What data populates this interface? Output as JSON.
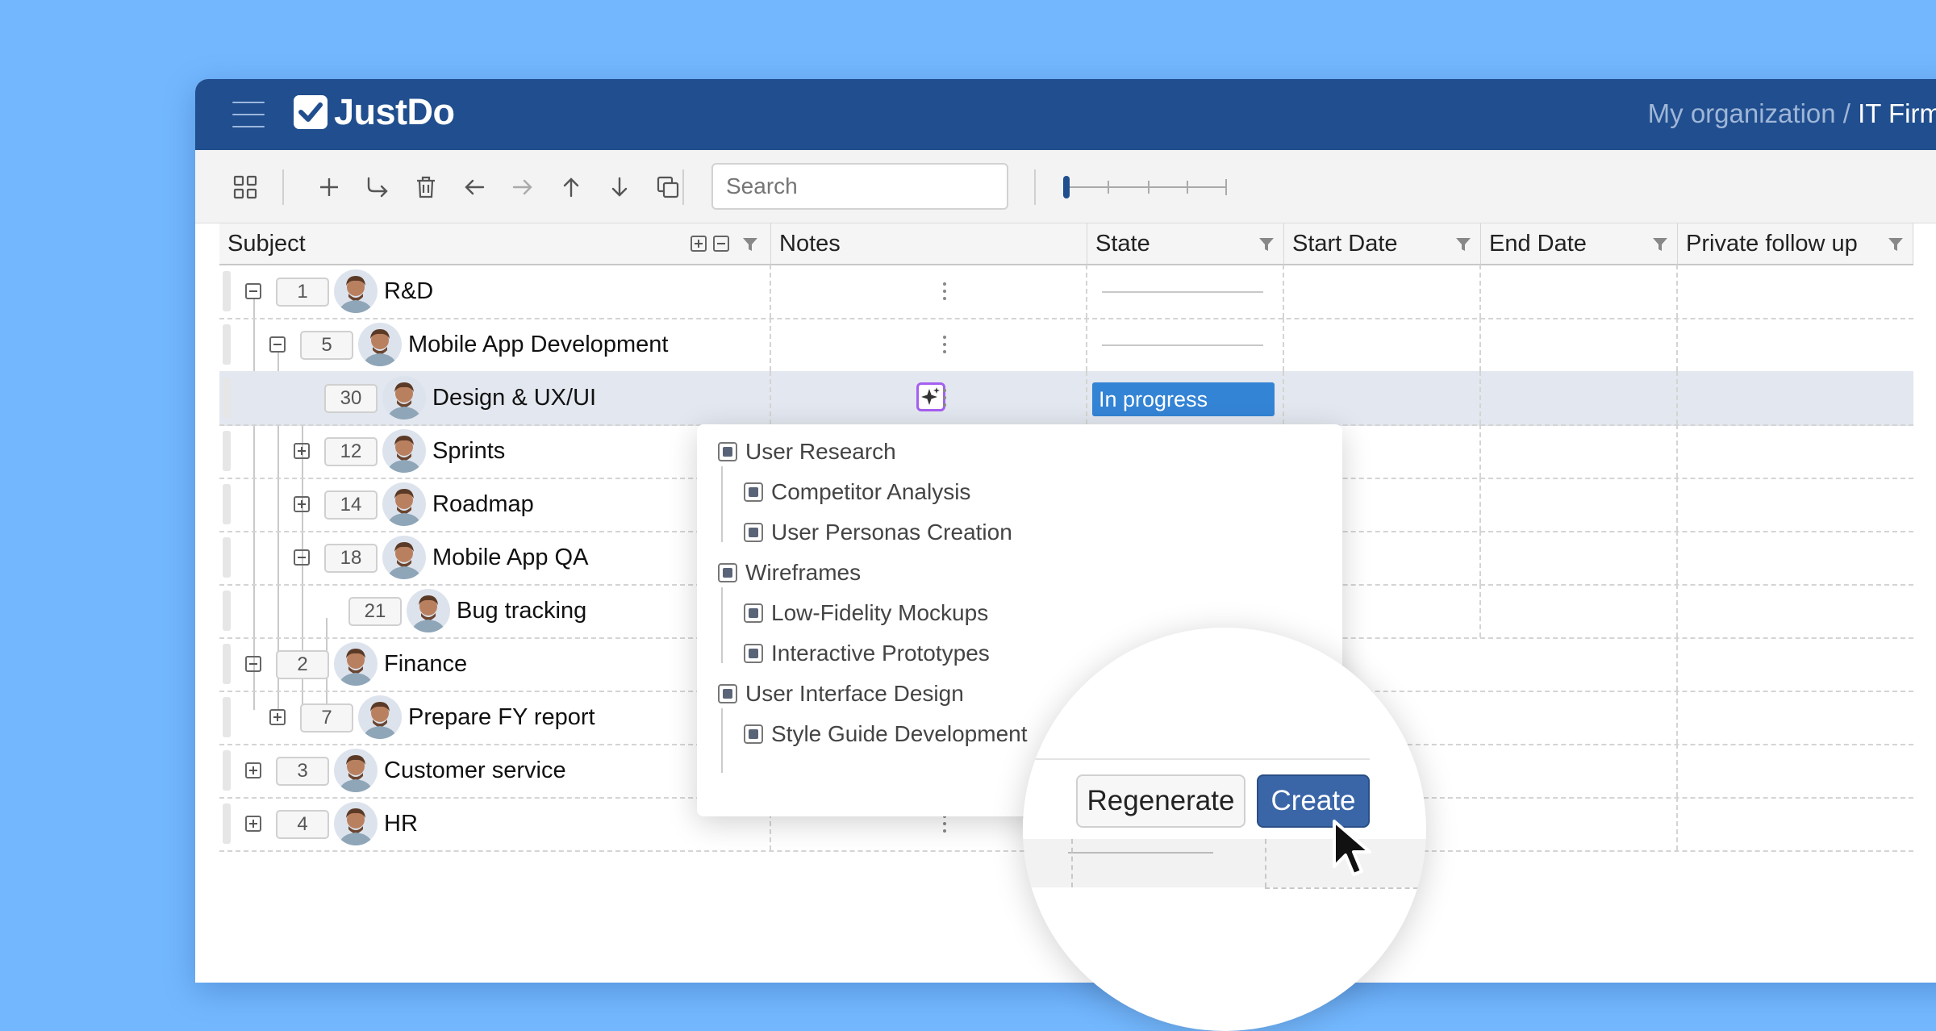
{
  "app": {
    "name": "JustDo",
    "org_prefix": "My organization /",
    "project": "IT Firm"
  },
  "toolbar": {
    "icons": [
      "grid-icon",
      "add-icon",
      "add-subtask-icon",
      "delete-icon",
      "outdent-icon",
      "indent-icon",
      "move-up-icon",
      "move-down-icon",
      "duplicate-icon"
    ],
    "search_placeholder": "Search"
  },
  "columns": [
    "Subject",
    "Notes",
    "State",
    "Start Date",
    "End Date",
    "Private follow up"
  ],
  "rows": [
    {
      "seq": "1",
      "title": "R&D"
    },
    {
      "seq": "5",
      "title": "Mobile App Development"
    },
    {
      "seq": "30",
      "title": "Design & UX/UI",
      "state": "In progress"
    },
    {
      "seq": "12",
      "title": "Sprints"
    },
    {
      "seq": "14",
      "title": "Roadmap"
    },
    {
      "seq": "18",
      "title": "Mobile App QA"
    },
    {
      "seq": "21",
      "title": "Bug tracking"
    },
    {
      "seq": "2",
      "title": "Finance"
    },
    {
      "seq": "7",
      "title": "Prepare FY report"
    },
    {
      "seq": "3",
      "title": "Customer service"
    },
    {
      "seq": "4",
      "title": "HR"
    }
  ],
  "ai_panel": {
    "items": [
      {
        "label": "User Research"
      },
      {
        "label": "Competitor Analysis"
      },
      {
        "label": "User Personas Creation"
      },
      {
        "label": "Wireframes"
      },
      {
        "label": "Low-Fidelity Mockups"
      },
      {
        "label": "Interactive Prototypes"
      },
      {
        "label": "User Interface Design"
      },
      {
        "label": "Style Guide Development"
      }
    ],
    "regenerate_label": "Regenerate",
    "create_label": "Create"
  },
  "colors": {
    "header": "#204e8e",
    "background": "#73b8ff",
    "state_badge": "#3484d6",
    "create_button": "#3a66a8"
  }
}
